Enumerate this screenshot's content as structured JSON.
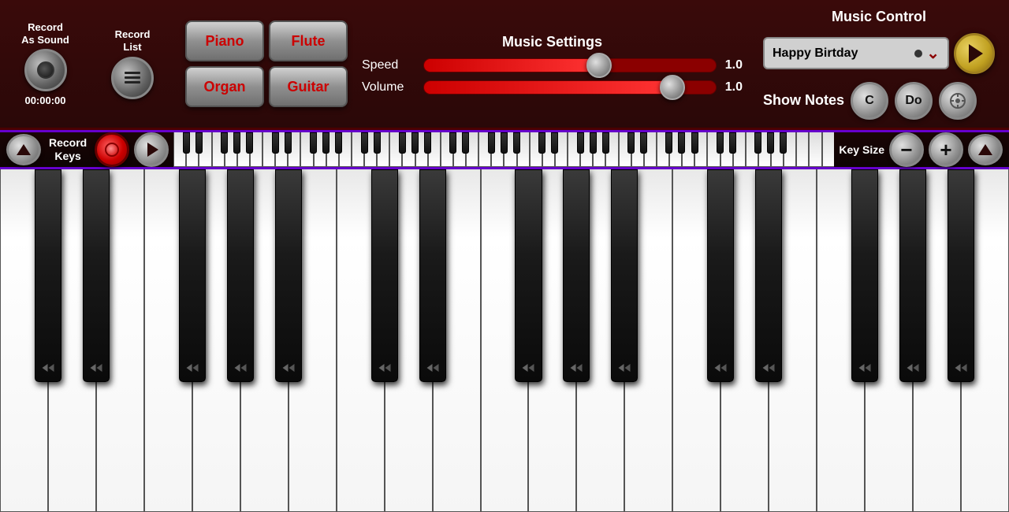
{
  "header": {
    "record_as_sound": "Record\nAs Sound",
    "record_as_sound_line1": "Record",
    "record_as_sound_line2": "As Sound",
    "timer": "00:00:00",
    "record_list": "Record\nList",
    "record_list_line1": "Record",
    "record_list_line2": "List",
    "music_settings_title": "Music Settings",
    "speed_label": "Speed",
    "speed_value": "1.0",
    "volume_label": "Volume",
    "volume_value": "1.0",
    "music_control_title": "Music Control",
    "song_name": "Happy Birtday",
    "show_notes_label": "Show Notes",
    "note_c": "C",
    "note_do": "Do"
  },
  "keyboard_bar": {
    "record_keys_label": "Record\nKeys",
    "record_keys_line1": "Record",
    "record_keys_line2": "Keys",
    "key_size_label": "Key Size"
  },
  "instruments": {
    "piano": "Piano",
    "flute": "Flute",
    "organ": "Organ",
    "guitar": "Guitar"
  }
}
